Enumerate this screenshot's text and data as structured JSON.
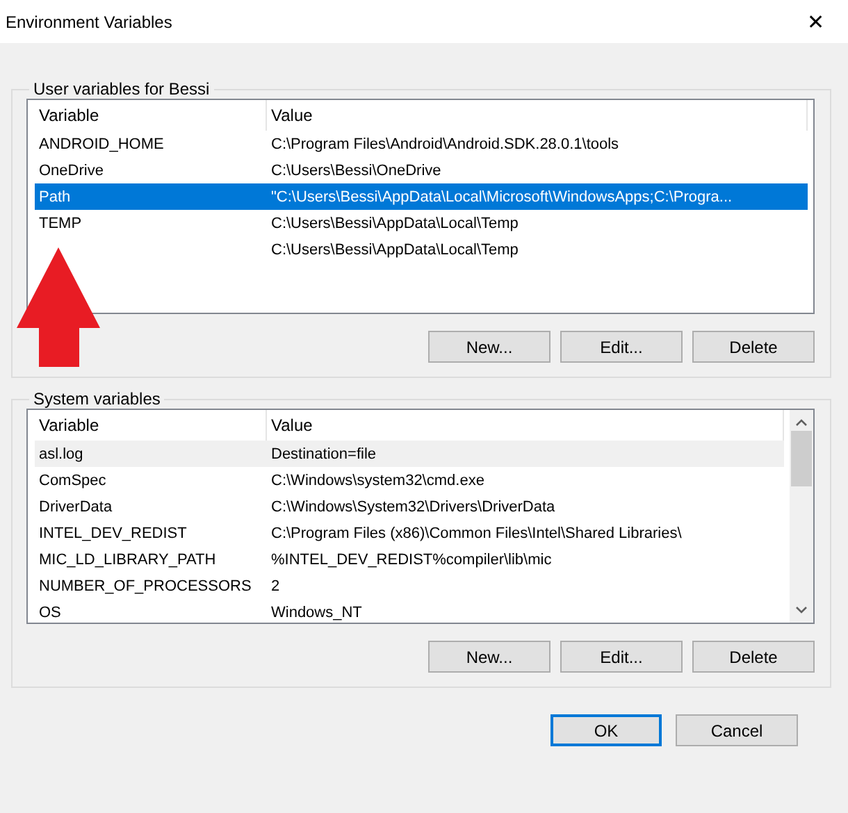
{
  "window": {
    "title": "Environment Variables",
    "close": "✕"
  },
  "groups": [
    {
      "title": "User variables for Bessi",
      "focused": true,
      "scrollbar": false,
      "columns": [
        "Variable",
        "Value"
      ],
      "rows": [
        {
          "variable": "ANDROID_HOME",
          "value": "C:\\Program Files\\Android\\Android.SDK.28.0.1\\tools",
          "selected": false
        },
        {
          "variable": "OneDrive",
          "value": "C:\\Users\\Bessi\\OneDrive",
          "selected": false
        },
        {
          "variable": "Path",
          "value": "\"C:\\Users\\Bessi\\AppData\\Local\\Microsoft\\WindowsApps;C:\\Progra...",
          "selected": true
        },
        {
          "variable": "TEMP",
          "value": "C:\\Users\\Bessi\\AppData\\Local\\Temp",
          "selected": false
        },
        {
          "value": "C:\\Users\\Bessi\\AppData\\Local\\Temp",
          "selected": false
        }
      ],
      "buttons": [
        "New...",
        "Edit...",
        "Delete"
      ]
    },
    {
      "title": "System variables",
      "focused": false,
      "scrollbar": true,
      "columns": [
        "Variable",
        "Value"
      ],
      "rows": [
        {
          "variable": "asl.log",
          "value": "Destination=file",
          "selected": true
        },
        {
          "variable": "ComSpec",
          "value": "C:\\Windows\\system32\\cmd.exe",
          "selected": false
        },
        {
          "variable": "DriverData",
          "value": "C:\\Windows\\System32\\Drivers\\DriverData",
          "selected": false
        },
        {
          "variable": "INTEL_DEV_REDIST",
          "value": "C:\\Program Files (x86)\\Common Files\\Intel\\Shared Libraries\\",
          "selected": false
        },
        {
          "variable": "MIC_LD_LIBRARY_PATH",
          "value": "%INTEL_DEV_REDIST%compiler\\lib\\mic",
          "selected": false
        },
        {
          "variable": "NUMBER_OF_PROCESSORS",
          "value": "2",
          "selected": false
        },
        {
          "variable": "OS",
          "value": "Windows_NT",
          "selected": false
        }
      ],
      "buttons": [
        "New...",
        "Edit...",
        "Delete"
      ]
    }
  ],
  "buttons": [
    {
      "label": "OK",
      "default": true
    },
    {
      "label": "Cancel",
      "default": false
    }
  ]
}
